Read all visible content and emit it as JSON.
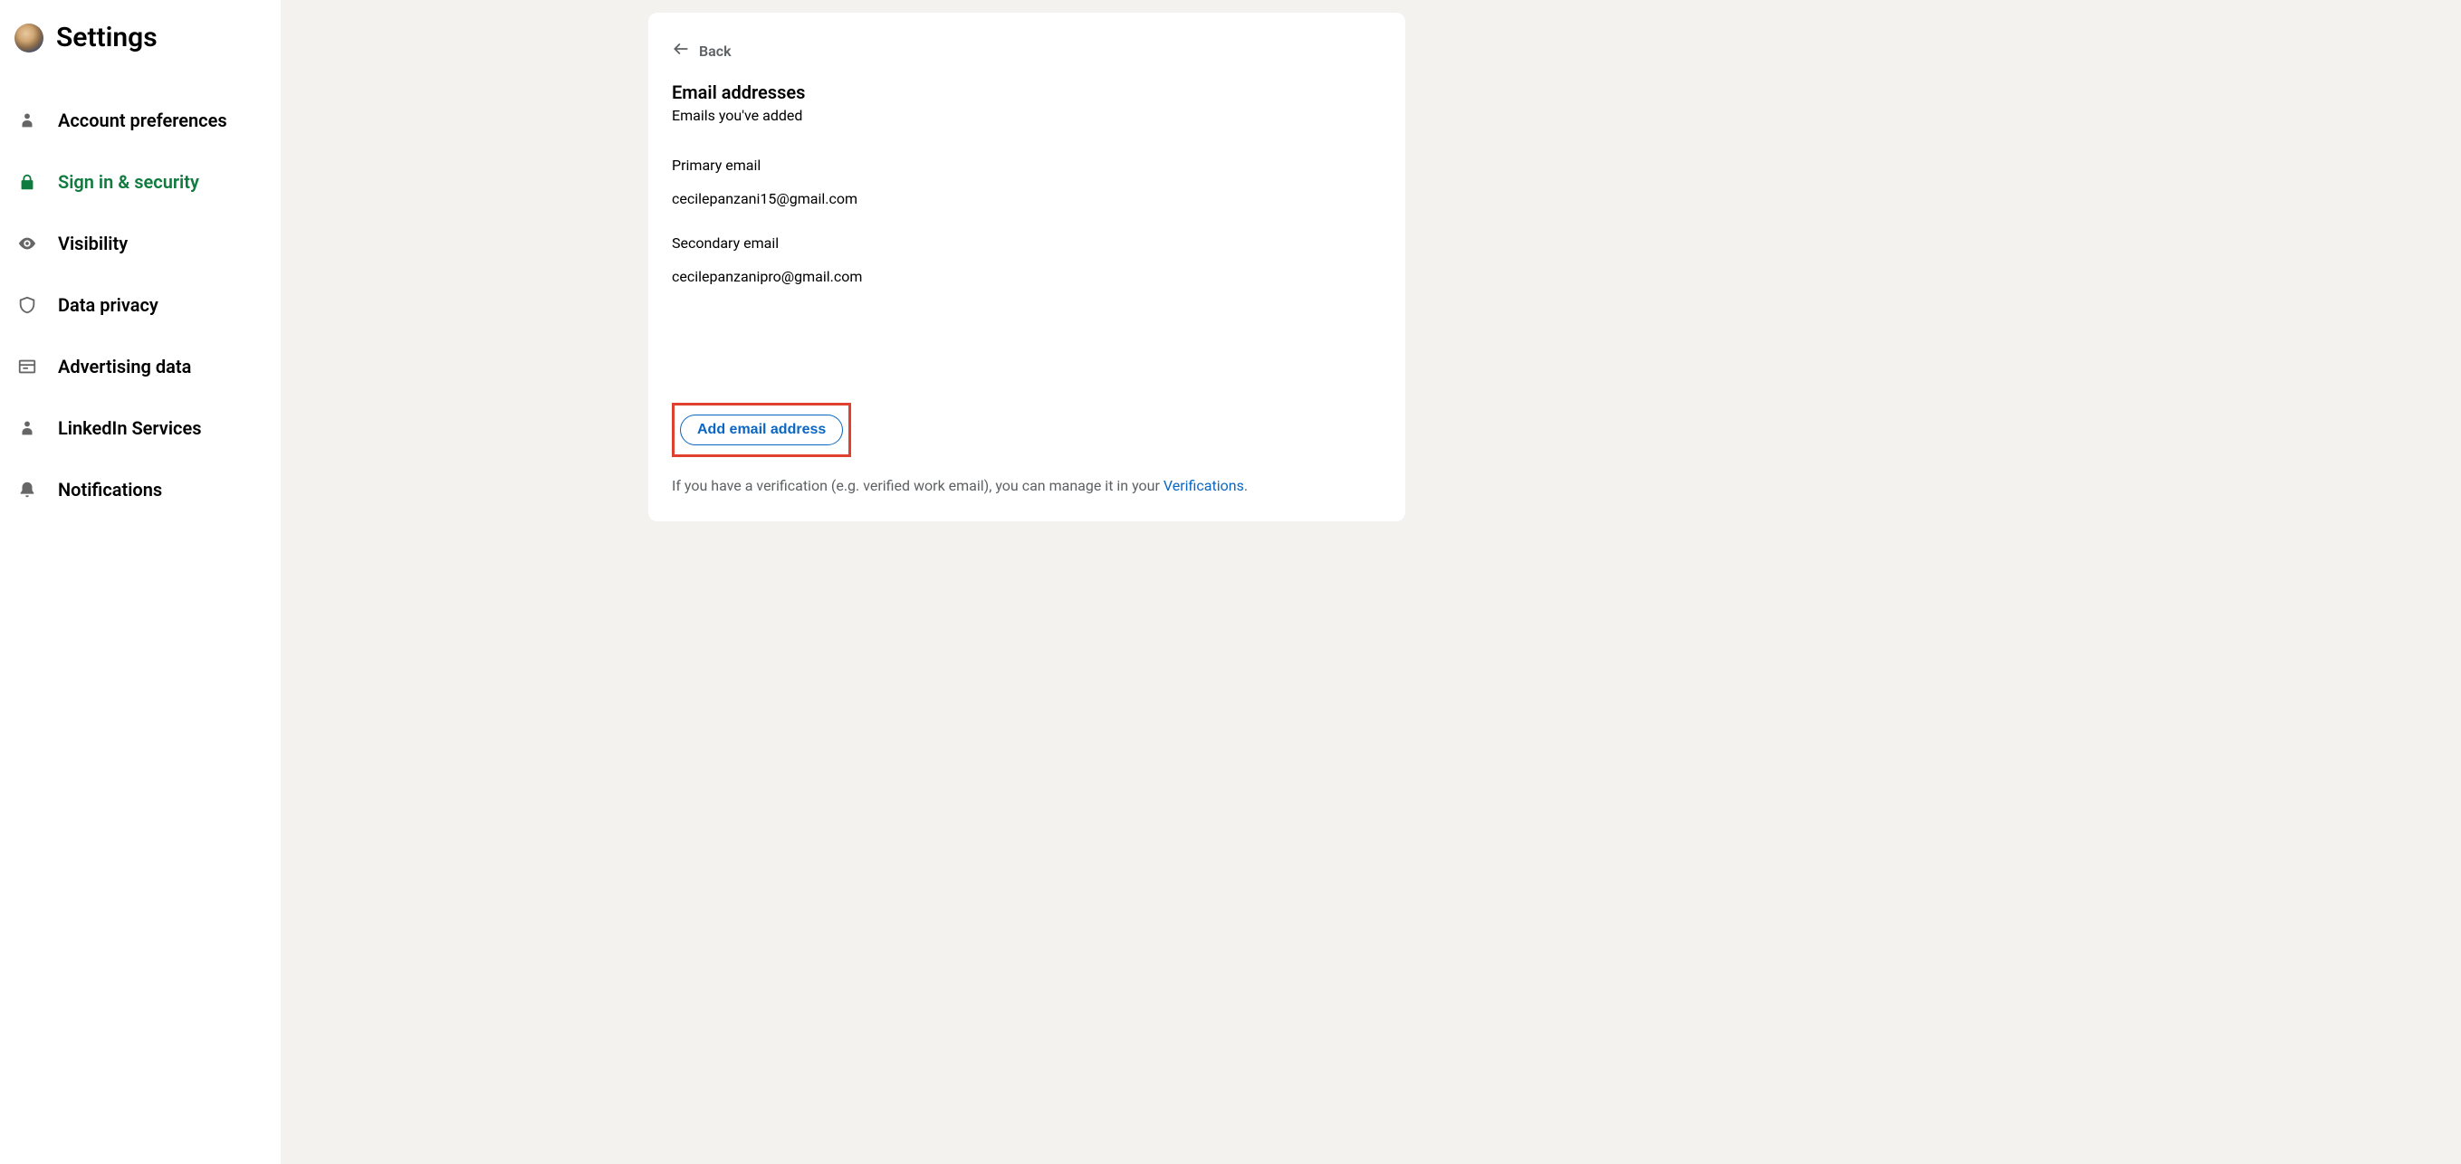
{
  "header": {
    "title": "Settings"
  },
  "sidebar": {
    "items": [
      {
        "label": "Account preferences"
      },
      {
        "label": "Sign in & security"
      },
      {
        "label": "Visibility"
      },
      {
        "label": "Data privacy"
      },
      {
        "label": "Advertising data"
      },
      {
        "label": "LinkedIn Services"
      },
      {
        "label": "Notifications"
      }
    ]
  },
  "content": {
    "back_label": "Back",
    "title": "Email addresses",
    "subtitle": "Emails you've added",
    "primary_label": "Primary email",
    "primary_value": "cecilepanzani15@gmail.com",
    "secondary_label": "Secondary email",
    "secondary_value": "cecilepanzanipro@gmail.com",
    "add_button": "Add email address",
    "footnote_prefix": "If you have a verification (e.g. verified work email), you can manage it in your ",
    "footnote_link": "Verifications",
    "footnote_suffix": "."
  }
}
